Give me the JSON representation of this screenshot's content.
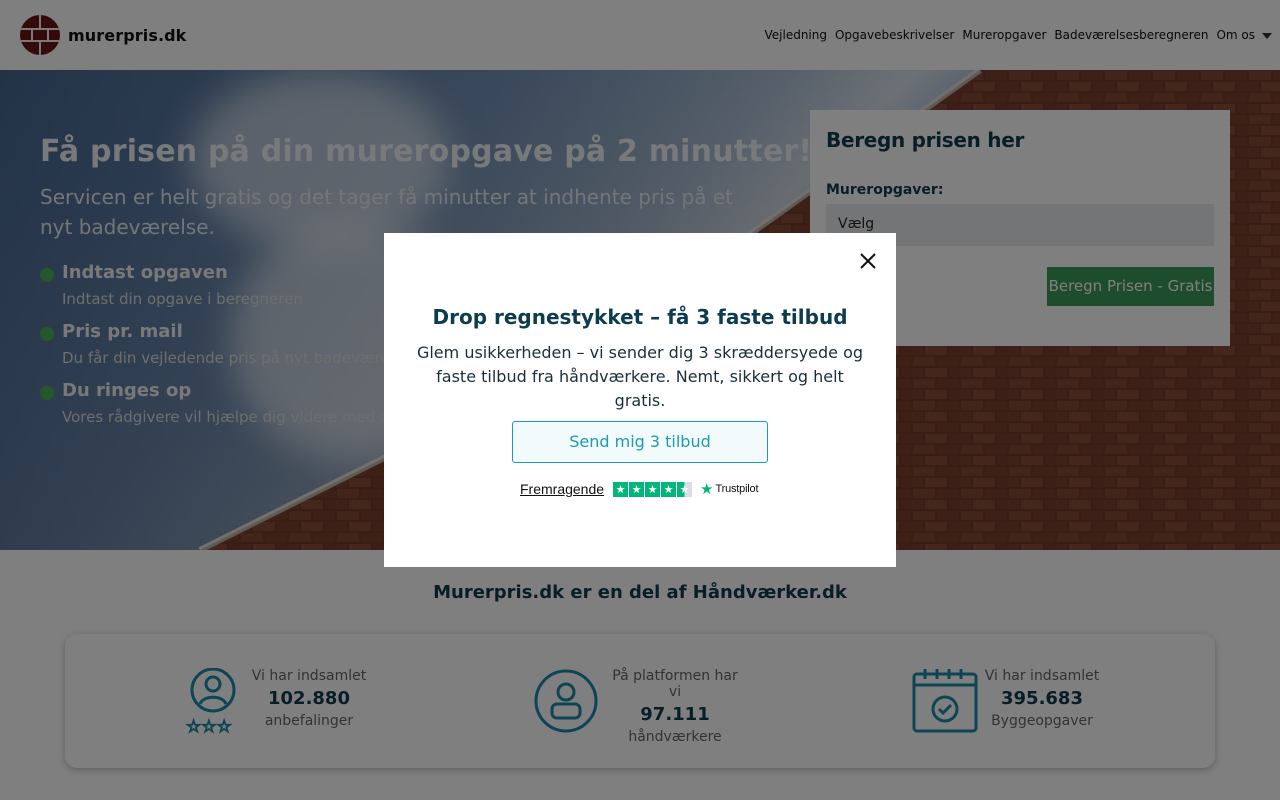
{
  "header": {
    "logo_text": "murerpris.dk",
    "nav": [
      {
        "label": "Vejledning"
      },
      {
        "label": "Opgavebeskrivelser"
      },
      {
        "label": "Mureropgaver"
      },
      {
        "label": "Badeværelsesberegneren"
      },
      {
        "label": "Om os"
      }
    ]
  },
  "hero": {
    "title": "Få prisen på din mureropgave på 2 minutter!",
    "subtitle": "Servicen er helt gratis og det tager få minutter at indhente pris på et nyt badeværelse.",
    "features": [
      {
        "title": "Indtast opgaven",
        "desc": "Indtast din opgave i beregneren"
      },
      {
        "title": "Pris pr. mail",
        "desc": "Du får din vejledende pris på nyt badeværelse"
      },
      {
        "title": "Du ringes op",
        "desc": "Vores rådgivere vil hjælpe dig videre med din opgave"
      }
    ]
  },
  "calculator": {
    "title": "Beregn prisen her",
    "label": "Mureropgaver:",
    "select_value": "Vælg",
    "button": "Beregn Prisen - Gratis"
  },
  "partner_text": "Murerpris.dk er en del af Håndværker.dk",
  "stats": [
    {
      "icon": "user-stars-icon",
      "top": "Vi har indsamlet",
      "value": "102.880",
      "bottom": "anbefalinger"
    },
    {
      "icon": "craftsman-icon",
      "top": "På platformen har vi",
      "value": "97.111",
      "bottom": "håndværkere"
    },
    {
      "icon": "calendar-check-icon",
      "top": "Vi har indsamlet",
      "value": "395.683",
      "bottom": "Byggeopgaver"
    }
  ],
  "modal": {
    "title": "Drop regnestykket – få 3 faste tilbud",
    "body": "Glem usikkerheden – vi sender dig 3 skræddersyede og faste tilbud fra håndværkere. Nemt, sikkert og helt gratis.",
    "button": "Send mig 3 tilbud",
    "trustpilot_label": "Fremragende",
    "trustpilot_brand": "Trustpilot",
    "trustpilot_stars": 4.5
  },
  "colors": {
    "brand_dark": "#0e3c4f",
    "accent_green": "#3d9b5a",
    "modal_button": "#1b9bb5",
    "trustpilot_green": "#00b67a",
    "logo_red": "#6b1414"
  }
}
